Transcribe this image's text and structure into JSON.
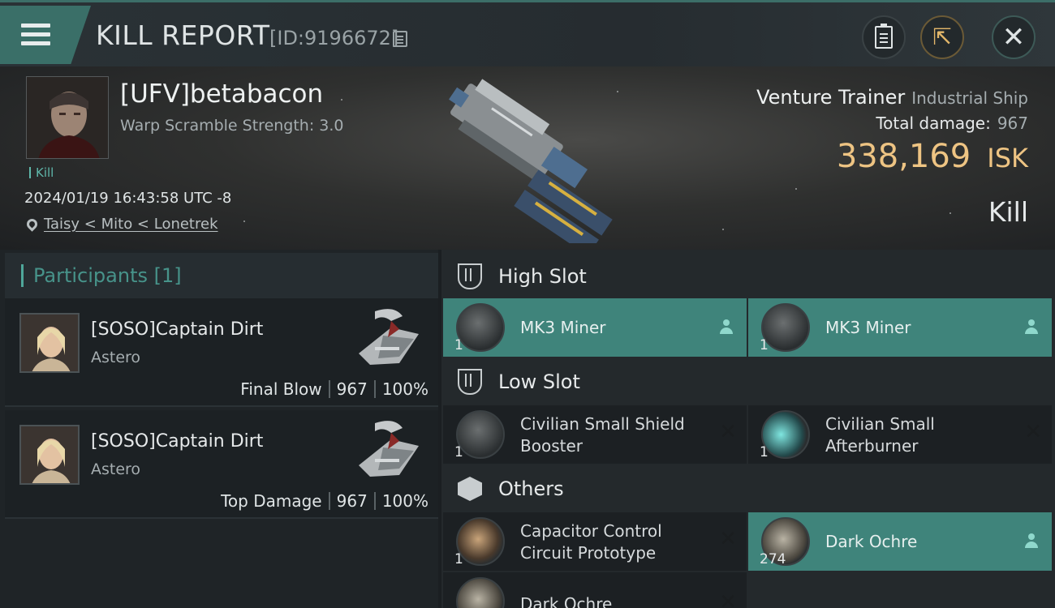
{
  "header": {
    "title": "KILL REPORT",
    "report_id": "[ID:9196672]"
  },
  "victim": {
    "name": "[UFV]betabacon",
    "warp_scramble": "Warp Scramble Strength: 3.0",
    "tag": "Kill",
    "timestamp": "2024/01/19 16:43:58 UTC -8",
    "location": "Taisy < Mito < Lonetrek"
  },
  "ship": {
    "name": "Venture Trainer",
    "class": "Industrial Ship",
    "damage_label": "Total damage:",
    "damage_value": "967",
    "isk_value": "338,169",
    "isk_unit": "ISK",
    "result": "Kill"
  },
  "participants": {
    "title": "Participants [1]",
    "items": [
      {
        "name": "[SOSO]Captain Dirt",
        "ship": "Astero",
        "role": "Final Blow",
        "damage": "967",
        "percent": "100%"
      },
      {
        "name": "[SOSO]Captain Dirt",
        "ship": "Astero",
        "role": "Top Damage",
        "damage": "967",
        "percent": "100%"
      }
    ]
  },
  "slots": {
    "high_title": "High Slot",
    "high": [
      {
        "name": "MK3 Miner",
        "qty": "1"
      },
      {
        "name": "MK3 Miner",
        "qty": "1"
      }
    ],
    "low_title": "Low Slot",
    "low": [
      {
        "line1": "Civilian Small Shield",
        "line2": "Booster",
        "qty": "1"
      },
      {
        "line1": "Civilian Small",
        "line2": "Afterburner",
        "qty": "1"
      }
    ],
    "others_title": "Others",
    "others": [
      {
        "line1": "Capacitor Control",
        "line2": "Circuit Prototype",
        "qty": "1"
      },
      {
        "name": "Dark Ochre",
        "qty": "274"
      },
      {
        "name": "Dark Ochre"
      }
    ]
  },
  "colors": {
    "accent": "#3f847b",
    "isk": "#eec483",
    "panel": "#1c2023"
  }
}
